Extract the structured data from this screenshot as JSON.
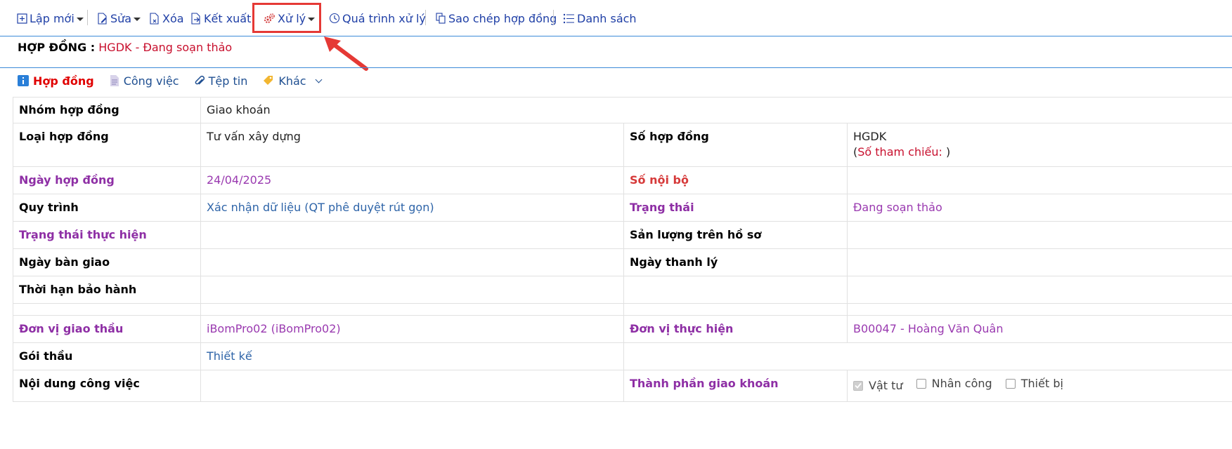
{
  "toolbar": {
    "new_label": "Lập mới",
    "edit_label": "Sửa",
    "delete_label": "Xóa",
    "export_label": "Kết xuất",
    "process_label": "Xử lý",
    "history_label": "Quá trình xử lý",
    "copy_label": "Sao chép hợp đồng",
    "list_label": "Danh sách"
  },
  "header": {
    "title_label": "HỢP ĐỒNG :",
    "title_value": "HGDK - Đang soạn thảo"
  },
  "tabs": [
    {
      "label": "Hợp đồng"
    },
    {
      "label": "Công việc"
    },
    {
      "label": "Tệp tin"
    },
    {
      "label": "Khác"
    }
  ],
  "fields": {
    "group_label": "Nhóm hợp đồng",
    "group_value": "Giao khoán",
    "type_label": "Loại hợp đồng",
    "type_value": "Tư vấn xây dựng",
    "contract_no_label": "Số hợp đồng",
    "contract_no_value": "HGDK",
    "ref_open": "(",
    "ref_label": "Số tham chiếu:",
    "ref_close": ")",
    "date_label": "Ngày hợp đồng",
    "date_value": "24/04/2025",
    "internal_no_label": "Số nội bộ",
    "process_label": "Quy trình",
    "process_value": "Xác nhận dữ liệu (QT phê duyệt rút gọn)",
    "status_label": "Trạng thái",
    "status_value": "Đang soạn thảo",
    "exec_status_label": "Trạng thái thực hiện",
    "output_label": "Sản lượng trên hồ sơ",
    "handover_label": "Ngày bàn giao",
    "liquidation_label": "Ngày thanh lý",
    "warranty_label": "Thời hạn bảo hành",
    "assigner_label": "Đơn vị giao thầu",
    "assigner_value": "iBomPro02 (iBomPro02)",
    "executor_label": "Đơn vị thực hiện",
    "executor_value": "B00047 - Hoàng Văn Quân",
    "package_label": "Gói thầu",
    "package_value": "Thiết kế",
    "work_content_label": "Nội dung công việc",
    "components_label": "Thành phần giao khoán",
    "components": [
      {
        "label": "Vật tư",
        "checked": true
      },
      {
        "label": "Nhân công",
        "checked": false
      },
      {
        "label": "Thiết bị",
        "checked": false
      }
    ]
  },
  "colors": {
    "toolbar_text": "#1f3fa6",
    "highlight": "#e53935",
    "label_purple": "#8e2fa5",
    "value_purple": "#9a3ab0",
    "value_blue": "#2e64a8",
    "status_red": "#c8102e"
  }
}
